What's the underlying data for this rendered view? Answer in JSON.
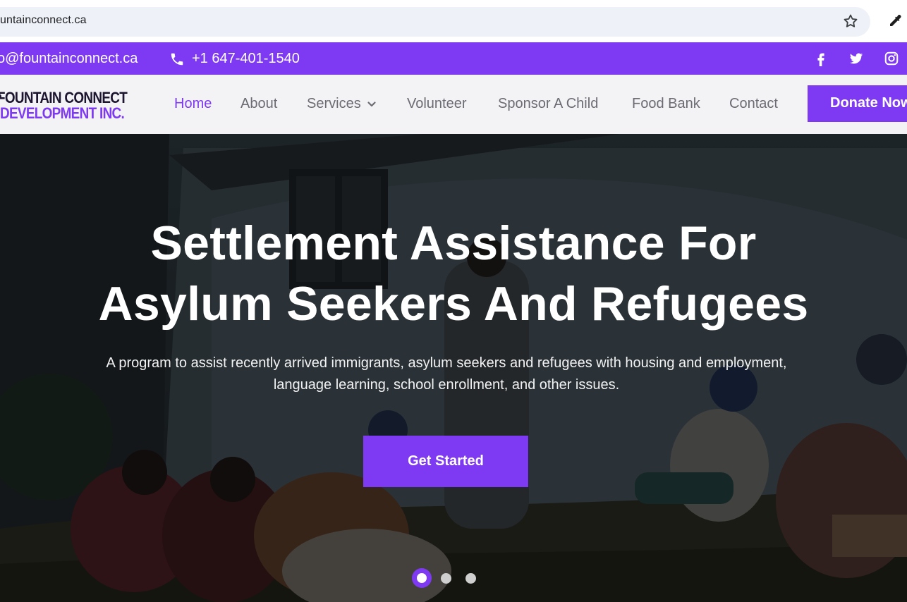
{
  "browser": {
    "url": "untainconnect.ca",
    "star_icon": "star-outline-icon",
    "extension_icon": "eyedropper-icon"
  },
  "topbar": {
    "email": "o@fountainconnect.ca",
    "phone": "+1 647-401-1540",
    "phone_icon": "phone-icon",
    "social_icons": [
      "facebook-icon",
      "twitter-icon",
      "instagram-icon"
    ]
  },
  "nav": {
    "logo_line1": "FOUNTAIN CONNECT",
    "logo_line2": "DEVELOPMENT INC.",
    "items": [
      "Home",
      "About",
      "Services",
      "Volunteer",
      "Sponsor A Child",
      "Food Bank",
      "Contact"
    ],
    "active": "Home",
    "donate_label": "Donate Now"
  },
  "hero": {
    "title_line1": "Settlement Assistance For",
    "title_line2": "Asylum Seekers And Refugees",
    "subtitle_line1": "A program to assist recently arrived immigrants, asylum seekers and refugees with housing and employment,",
    "subtitle_line2": "language learning, school enrollment, and other issues.",
    "cta_label": "Get Started",
    "slide_count": 3,
    "active_slide": 1
  },
  "colors": {
    "accent": "#7e3af2",
    "nav_bg": "#f3f3f5",
    "nav_text": "#6b6b73",
    "hero_overlay": "#2b3238"
  }
}
